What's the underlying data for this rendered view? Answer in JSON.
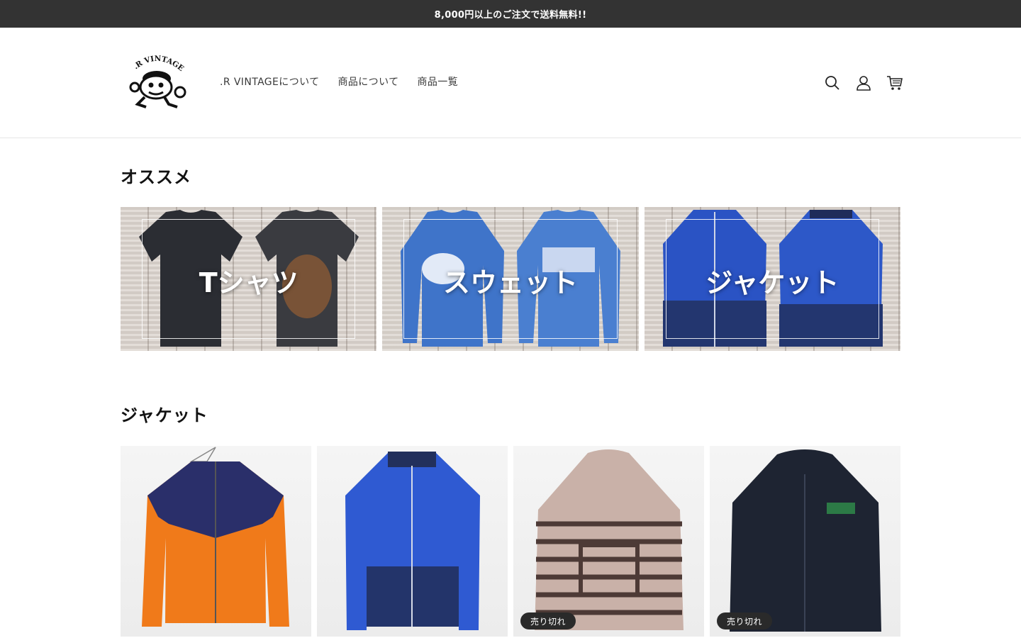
{
  "announcement": {
    "text": "8,000円以上のご注文で送料無料!!"
  },
  "header": {
    "logo_text": ".R VINTAGE",
    "nav": [
      {
        "label": ".R VINTAGEについて"
      },
      {
        "label": "商品について"
      },
      {
        "label": "商品一覧"
      }
    ],
    "icons": [
      "search-icon",
      "account-icon",
      "cart-icon"
    ]
  },
  "featured": {
    "title": "オススメ",
    "collections": [
      {
        "label": "Tシャツ",
        "colors": [
          "#2b2d33",
          "#3a3b40"
        ]
      },
      {
        "label": "スウェット",
        "colors": [
          "#3f74c9",
          "#4a7fd0"
        ]
      },
      {
        "label": "ジャケット",
        "colors": [
          "#2a53c4",
          "#23366f"
        ]
      }
    ]
  },
  "jackets": {
    "title": "ジャケット",
    "products": [
      {
        "name": "jacket-orange-navy",
        "sold_out": ""
      },
      {
        "name": "jacket-blue-adidas",
        "sold_out": ""
      },
      {
        "name": "baja-hoodie",
        "sold_out": "売り切れ"
      },
      {
        "name": "black-work-jacket",
        "sold_out": "売り切れ"
      }
    ]
  },
  "colors": {
    "announcement_bg": "#333333",
    "badge_bg": "#2a2a2a"
  }
}
